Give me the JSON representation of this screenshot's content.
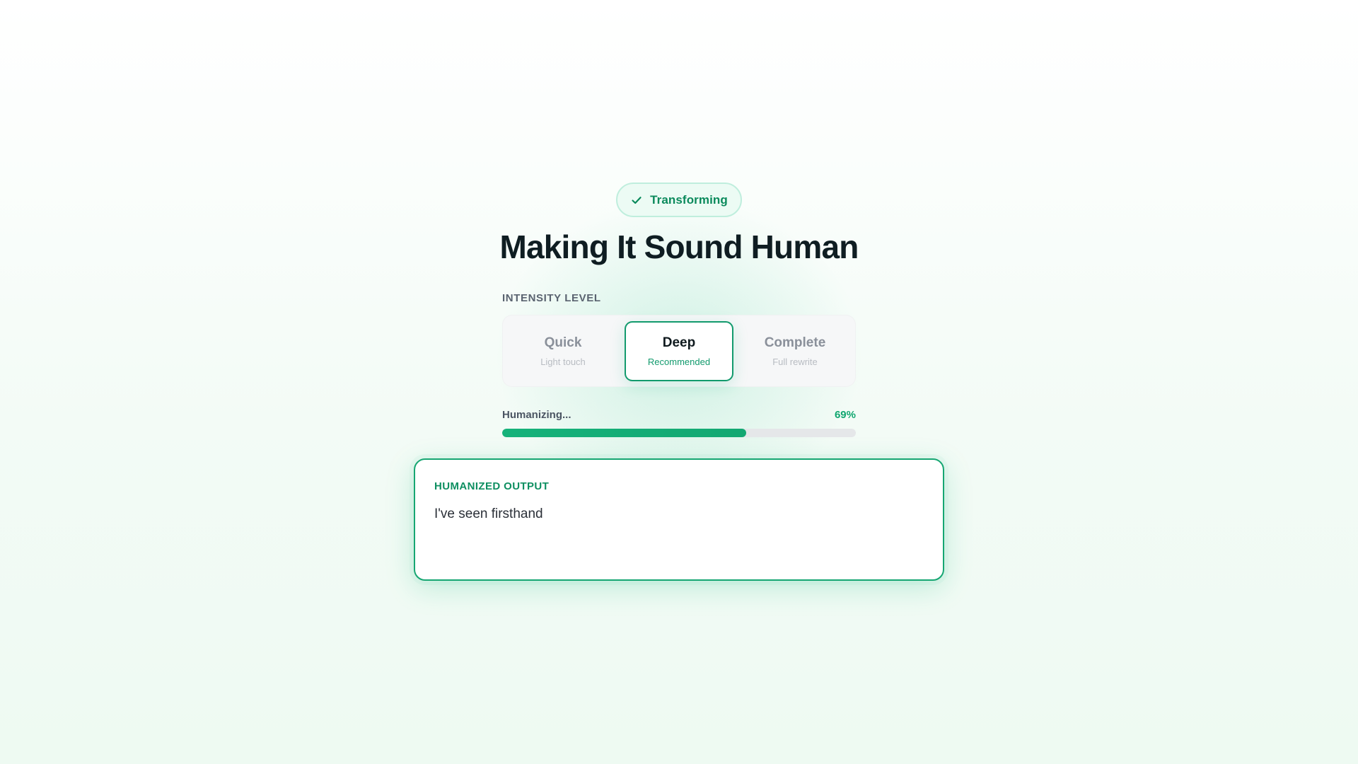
{
  "status": {
    "label": "Transforming",
    "icon": "check-icon",
    "color": "#0b8a5c"
  },
  "title": "Making It Sound Human",
  "intensity": {
    "label": "INTENSITY LEVEL",
    "options": [
      {
        "title": "Quick",
        "subtitle": "Light touch",
        "selected": false
      },
      {
        "title": "Deep",
        "subtitle": "Recommended",
        "selected": true
      },
      {
        "title": "Complete",
        "subtitle": "Full rewrite",
        "selected": false
      }
    ]
  },
  "progress": {
    "label": "Humanizing...",
    "percent_text": "69%",
    "value": 0.69
  },
  "output": {
    "heading": "HUMANIZED OUTPUT",
    "text": "I've seen firsthand"
  },
  "colors": {
    "accent": "#10b981",
    "accent_dark": "#0e8f61",
    "title": "#0f1d22"
  }
}
